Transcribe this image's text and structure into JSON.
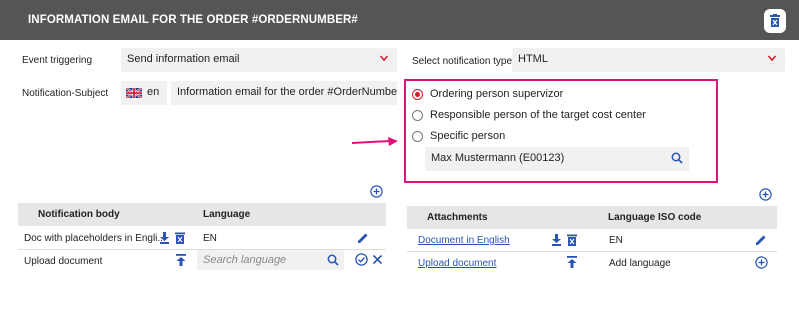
{
  "header": {
    "title": "INFORMATION EMAIL FOR THE ORDER #ORDERNUMBER#"
  },
  "form": {
    "event_triggering_label": "Event triggering",
    "event_triggering_value": "Send information email",
    "notification_subject_label": "Notification-Subject",
    "subject_language": "en",
    "subject_value": "Information email for the order #OrderNumber#",
    "notification_type_label": "Select notification type*",
    "notification_type_value": "HTML"
  },
  "recipient_options": [
    {
      "label": "Ordering person supervizor",
      "selected": true
    },
    {
      "label": "Responsible person of the target cost center",
      "selected": false
    },
    {
      "label": "Specific person",
      "selected": false
    }
  ],
  "specific_person_value": "Max Mustermann (E00123)",
  "body_table": {
    "headers": [
      "Notification body",
      "Language"
    ],
    "rows": [
      {
        "name": "Doc with placeholders in Engli...",
        "language": "EN"
      },
      {
        "name": "Upload document",
        "language_placeholder": "Search language"
      }
    ]
  },
  "attachments_table": {
    "headers": [
      "Attachments",
      "Language ISO code"
    ],
    "rows": [
      {
        "name": "Document in English",
        "language": "EN"
      },
      {
        "name": "Upload document",
        "language": "Add language"
      }
    ]
  },
  "colors": {
    "header_bg": "#555555",
    "accent_blue": "#2a54b3",
    "highlight_pink": "#e0107f",
    "radio_red": "#d21f2b",
    "chevron_red": "#d21f2b"
  },
  "icons": {
    "header_button": "delete-icon",
    "select_chevron": "chevron-down-icon",
    "add": "plus-circle-icon",
    "download": "download-icon",
    "delete": "trash-icon",
    "upload": "upload-icon",
    "search": "search-icon",
    "edit": "pencil-icon",
    "confirm": "check-circle-icon",
    "cancel": "close-icon",
    "annotation_arrow": "arrow-right-icon"
  }
}
